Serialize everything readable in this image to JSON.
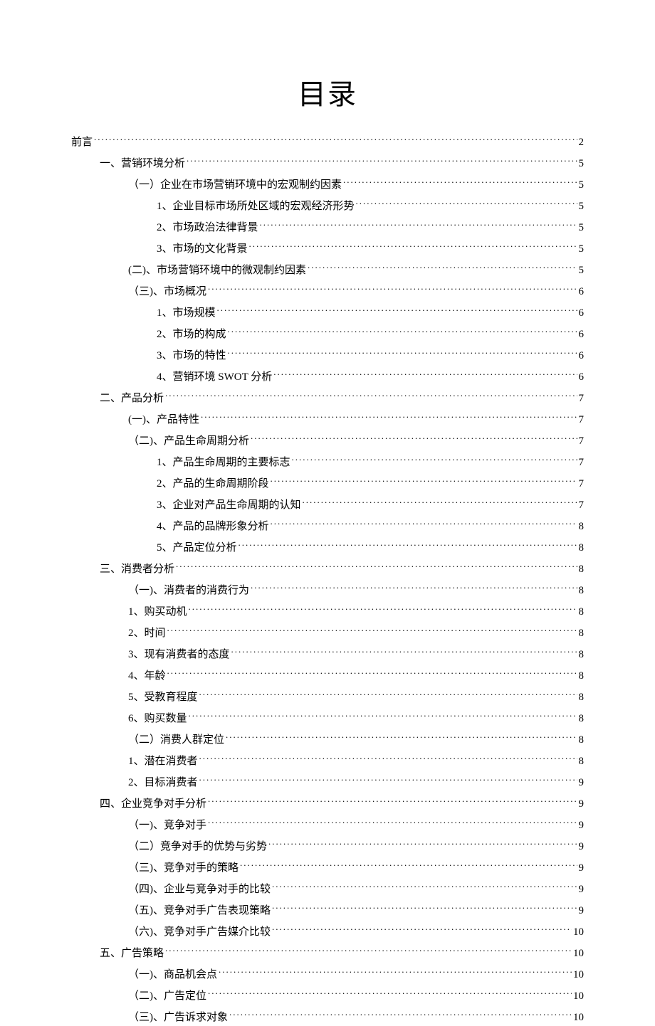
{
  "title": "目录",
  "entries": [
    {
      "label": "前言",
      "page": "2",
      "indent": 0
    },
    {
      "label": "一、营销环境分析",
      "page": "5",
      "indent": 1
    },
    {
      "label": "（一）企业在市场营销环境中的宏观制约因素",
      "page": "5",
      "indent": 2
    },
    {
      "label": "1、企业目标市场所处区域的宏观经济形势",
      "page": "5",
      "indent": 3
    },
    {
      "label": "2、市场政治法律背景",
      "page": "5",
      "indent": 3
    },
    {
      "label": "3、市场的文化背景",
      "page": "5",
      "indent": 3
    },
    {
      "label": "(二)、市场营销环境中的微观制约因素",
      "page": "5",
      "indent": 2
    },
    {
      "label": "（三)、市场概况",
      "page": "6",
      "indent": 2
    },
    {
      "label": "1、市场规模",
      "page": "6",
      "indent": 3
    },
    {
      "label": "2、市场的构成",
      "page": "6",
      "indent": 3
    },
    {
      "label": "3、市场的特性",
      "page": "6",
      "indent": 3
    },
    {
      "label": "4、营销环境 SWOT 分析",
      "page": "6",
      "indent": 3
    },
    {
      "label": "二、产品分析",
      "page": "7",
      "indent": 1
    },
    {
      "label": "(一)、产品特性",
      "page": "7",
      "indent": 2
    },
    {
      "label": "（二)、产品生命周期分析",
      "page": "7",
      "indent": 2
    },
    {
      "label": "1、产品生命周期的主要标志",
      "page": "7",
      "indent": 3
    },
    {
      "label": "2、产品的生命周期阶段",
      "page": "7",
      "indent": 3
    },
    {
      "label": "3、企业对产品生命周期的认知",
      "page": "7",
      "indent": 3
    },
    {
      "label": "4、产品的品牌形象分析",
      "page": "8",
      "indent": 3
    },
    {
      "label": "5、产品定位分析",
      "page": "8",
      "indent": 3
    },
    {
      "label": "三、消费者分析",
      "page": "8",
      "indent": 1
    },
    {
      "label": "（一)、消费者的消费行为",
      "page": "8",
      "indent": 2
    },
    {
      "label": "1、购买动机",
      "page": "8",
      "indent": 2
    },
    {
      "label": "2、时间",
      "page": "8",
      "indent": 2
    },
    {
      "label": "3、现有消费者的态度",
      "page": "8",
      "indent": 2
    },
    {
      "label": "4、年龄",
      "page": "8",
      "indent": 2
    },
    {
      "label": "5、受教育程度",
      "page": "8",
      "indent": 2
    },
    {
      "label": "6、购买数量",
      "page": "8",
      "indent": 2
    },
    {
      "label": "（二）消费人群定位",
      "page": "8",
      "indent": 2
    },
    {
      "label": "1、潜在消费者",
      "page": "8",
      "indent": 2
    },
    {
      "label": "2、目标消费者",
      "page": "9",
      "indent": 2
    },
    {
      "label": "四、企业竞争对手分析",
      "page": "9",
      "indent": 1
    },
    {
      "label": "（一)、竞争对手",
      "page": "9",
      "indent": 2
    },
    {
      "label": "（二）竞争对手的优势与劣势",
      "page": "9",
      "indent": 2
    },
    {
      "label": "（三)、竞争对手的策略",
      "page": "9",
      "indent": 2
    },
    {
      "label": "（四)、企业与竞争对手的比较",
      "page": "9",
      "indent": 2
    },
    {
      "label": "（五)、竞争对手广告表现策略",
      "page": "9",
      "indent": 2
    },
    {
      "label": "（六)、竞争对手广告媒介比较",
      "page": "10",
      "indent": 2
    },
    {
      "label": "五、广告策略",
      "page": "10",
      "indent": 1
    },
    {
      "label": "（一)、商品机会点",
      "page": "10",
      "indent": 2
    },
    {
      "label": "（二)、广告定位",
      "page": "10",
      "indent": 2
    },
    {
      "label": "（三)、广告诉求对象",
      "page": "10",
      "indent": 2
    }
  ]
}
